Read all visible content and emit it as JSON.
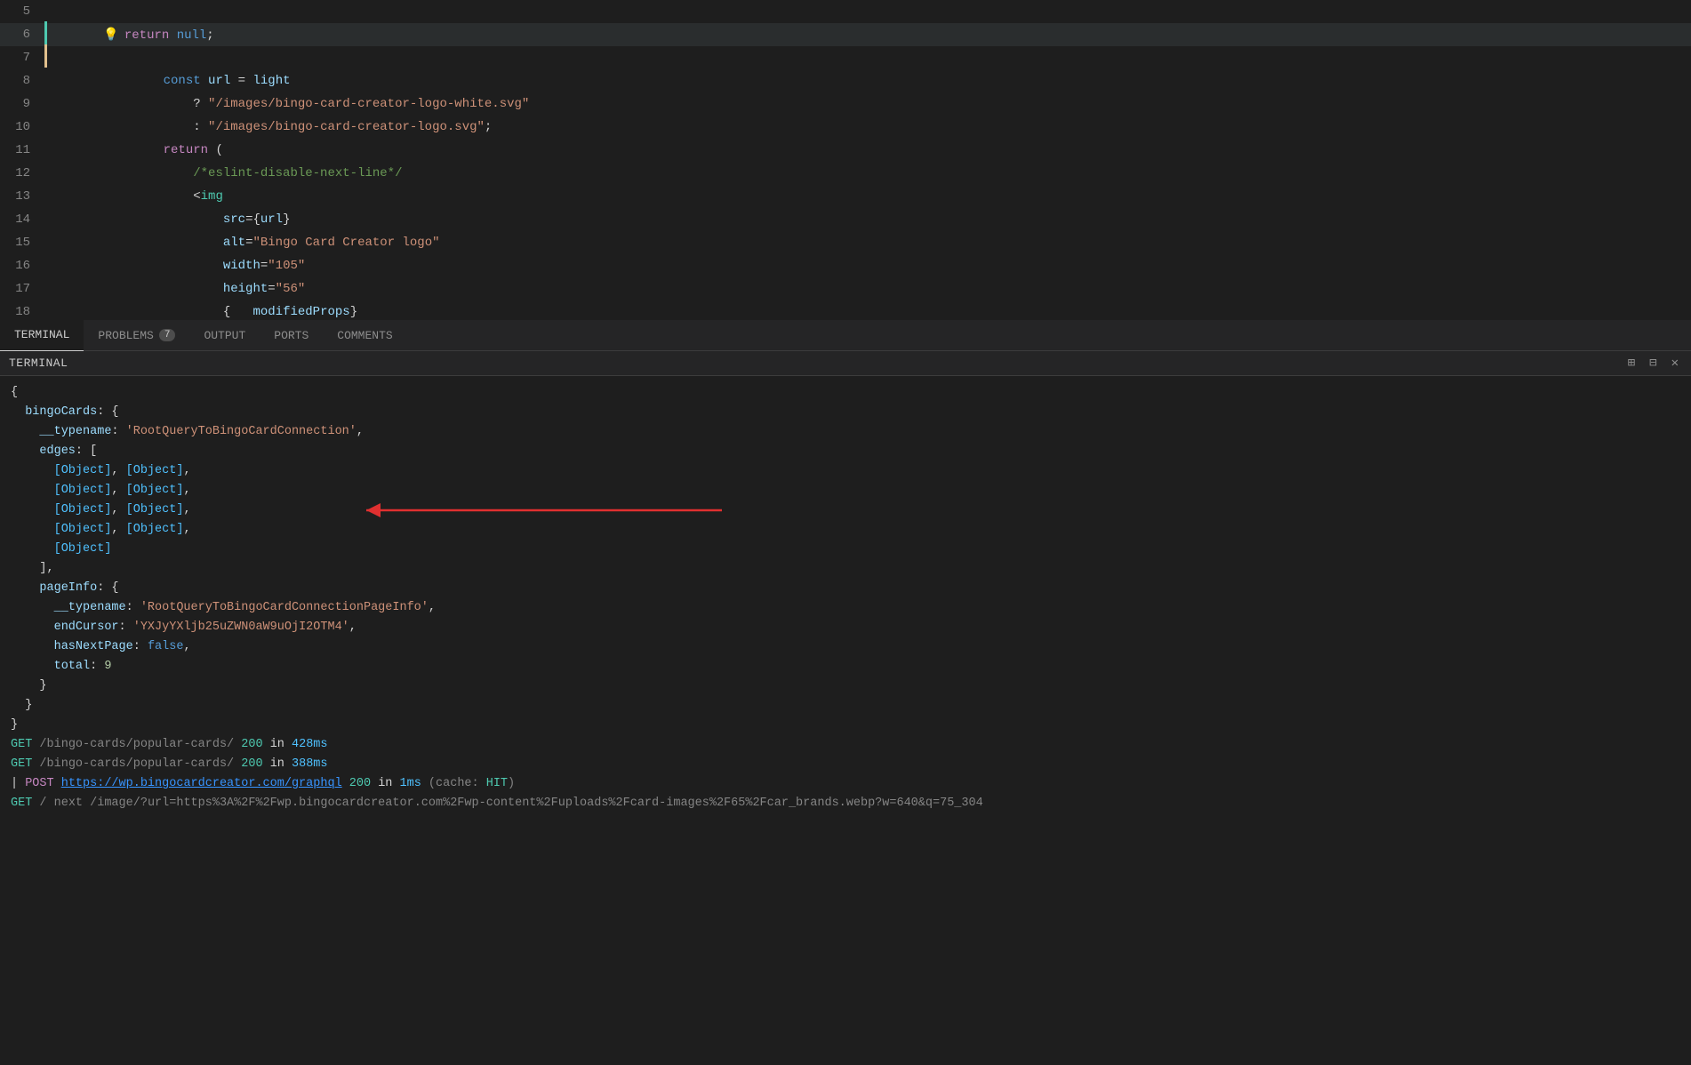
{
  "editor": {
    "lines": [
      {
        "num": "5",
        "indicator": "",
        "content": ""
      },
      {
        "num": "6",
        "indicator": "green",
        "content": "return null;",
        "has_lightbulb": true
      },
      {
        "num": "7",
        "indicator": "yellow",
        "content": ""
      },
      {
        "num": "8",
        "indicator": "",
        "content": "const url = light"
      },
      {
        "num": "9",
        "indicator": "",
        "content": "  ? \"/images/bingo-card-creator-logo-white.svg\""
      },
      {
        "num": "10",
        "indicator": "",
        "content": "  : \"/images/bingo-card-creator-logo.svg\";"
      },
      {
        "num": "11",
        "indicator": "",
        "content": "return ("
      },
      {
        "num": "12",
        "indicator": "",
        "content": "    /*eslint-disable-next-line*/"
      },
      {
        "num": "13",
        "indicator": "",
        "content": "    <img"
      },
      {
        "num": "14",
        "indicator": "",
        "content": "      src={url}"
      },
      {
        "num": "15",
        "indicator": "",
        "content": "      alt=\"Bingo Card Creator logo\""
      },
      {
        "num": "16",
        "indicator": "",
        "content": "      width=\"105\""
      },
      {
        "num": "17",
        "indicator": "",
        "content": "      height=\"56\""
      },
      {
        "num": "18",
        "indicator": "",
        "content": "      {   modifiedProps}"
      }
    ]
  },
  "panel_tabs": [
    {
      "label": "TERMINAL",
      "active": true,
      "badge": null
    },
    {
      "label": "PROBLEMS",
      "active": false,
      "badge": "7"
    },
    {
      "label": "OUTPUT",
      "active": false,
      "badge": null
    },
    {
      "label": "PORTS",
      "active": false,
      "badge": null
    },
    {
      "label": "COMMENTS",
      "active": false,
      "badge": null
    }
  ],
  "panel_header": {
    "title": "TERMINAL"
  },
  "terminal": {
    "lines": [
      "open_brace",
      "bingo_cards_open",
      "typename_bingo",
      "edges_open",
      "objects_1",
      "objects_2",
      "objects_3",
      "objects_4",
      "object_5",
      "edges_close",
      "pageinfo_open",
      "typename_pageinfo",
      "end_cursor",
      "has_next",
      "total",
      "pageinfo_close",
      "close_brace_inner",
      "close_brace_outer",
      "get_1",
      "get_2",
      "post_1",
      "get_3"
    ],
    "data": {
      "typename_bingo_value": "'RootQueryToBingoCardConnection'",
      "typename_pageinfo_value": "'RootQueryToBingoCardConnectionPageInfo'",
      "end_cursor_value": "'YXJyYXljb25uZWN0aW9uOjI2OTM4'",
      "has_next_value": "false",
      "total_value": "9",
      "get1_path": "/bingo-cards/popular-cards/",
      "get1_status": "200",
      "get1_time": "428ms",
      "get2_path": "/bingo-cards/popular-cards/",
      "get2_status": "200",
      "get2_time": "388ms",
      "post_url": "https://wp.bingocardcreator.com/graphql",
      "post_status": "200",
      "post_time": "1ms",
      "post_cache": "HIT",
      "get3_path": "/ next /image/?url=https%3A%2F%2Fwp.bingocardcreator.com%2Fwp-content%2Fuploads%2Fcard-images%2F65%2Fcar_brands.webp?w=640&q=75_304"
    }
  }
}
